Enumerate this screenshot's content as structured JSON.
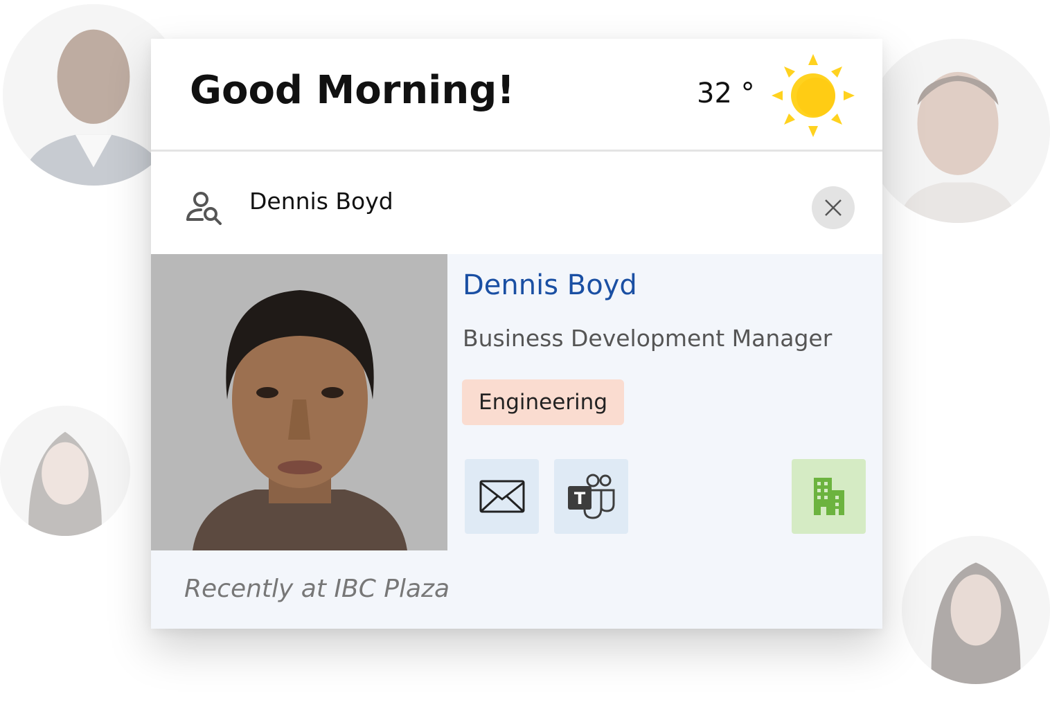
{
  "header": {
    "greeting": "Good Morning!",
    "temperature": "32 °",
    "weather_icon": "sun-icon"
  },
  "search": {
    "icon": "person-search-icon",
    "value": "Dennis Boyd",
    "clear_icon": "close-icon"
  },
  "result": {
    "name": "Dennis Boyd",
    "job_title": "Business Development Manager",
    "department": "Engineering",
    "location_note": "Recently at IBC Plaza",
    "actions": [
      {
        "name": "email",
        "icon": "mail-icon"
      },
      {
        "name": "teams",
        "icon": "teams-icon"
      },
      {
        "name": "office",
        "icon": "building-icon"
      }
    ]
  },
  "colors": {
    "name_link": "#1a4fa3",
    "department_badge": "#fadcd0",
    "action_bg": "#dfeaf5",
    "office_bg": "#d5ebc4",
    "office_icon": "#6cb33f",
    "sun": "#ffd21f"
  }
}
